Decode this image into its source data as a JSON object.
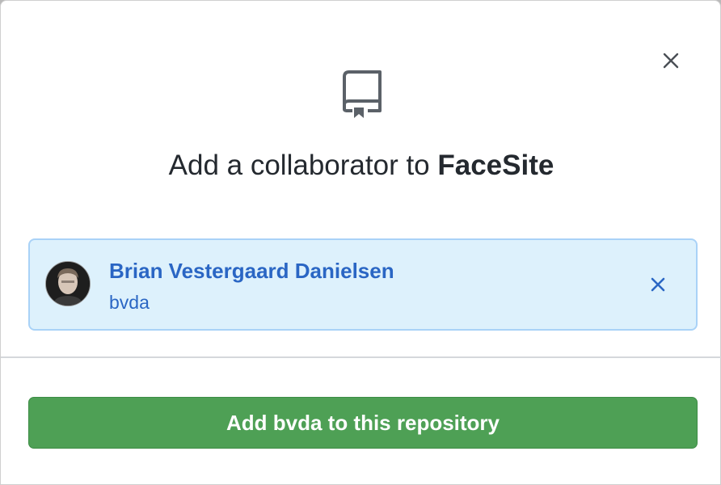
{
  "dialog": {
    "title_prefix": "Add a collaborator to ",
    "repo_name": "FaceSite",
    "close_icon": "close-icon",
    "repo_icon": "repo-book-icon"
  },
  "collaborator": {
    "name": "Brian Vestergaard Danielsen",
    "login": "bvda",
    "remove_icon": "close-icon"
  },
  "actions": {
    "add_button_label": "Add bvda to this repository"
  },
  "colors": {
    "link_blue": "#2a66c4",
    "selection_bg": "#ddf1fc",
    "selection_border": "#a9d2f7",
    "primary_green": "#4ea055"
  }
}
